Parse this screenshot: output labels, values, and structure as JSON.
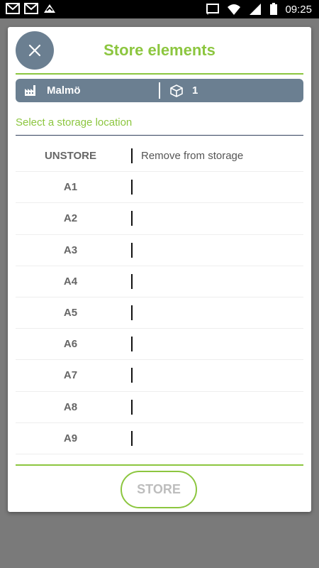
{
  "statusbar": {
    "time": "09:25",
    "left_icons": [
      "gmail-icon",
      "gmail-icon",
      "app-notification-icon"
    ],
    "right_icons": [
      "cast-icon",
      "wifi-icon",
      "signal-icon",
      "battery-icon"
    ]
  },
  "dialog": {
    "title": "Store elements",
    "close_icon": "close-icon"
  },
  "info": {
    "location": "Malmö",
    "count": "1",
    "location_icon": "factory-icon",
    "count_icon": "cube-icon"
  },
  "select_label": "Select a storage location",
  "storage_rows": [
    {
      "code": "UNSTORE",
      "desc": "Remove from storage"
    },
    {
      "code": "A1",
      "desc": ""
    },
    {
      "code": "A2",
      "desc": ""
    },
    {
      "code": "A3",
      "desc": ""
    },
    {
      "code": "A4",
      "desc": ""
    },
    {
      "code": "A5",
      "desc": ""
    },
    {
      "code": "A6",
      "desc": ""
    },
    {
      "code": "A7",
      "desc": ""
    },
    {
      "code": "A8",
      "desc": ""
    },
    {
      "code": "A9",
      "desc": ""
    }
  ],
  "store_button": "STORE",
  "colors": {
    "accent": "#8cc63f",
    "slate": "#6b7f91",
    "overlay": "#7a7a7a"
  }
}
